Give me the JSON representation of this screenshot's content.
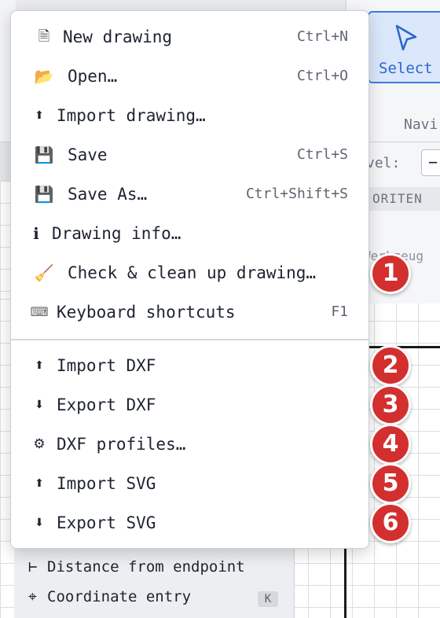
{
  "menu": {
    "items": [
      {
        "icon": "🗎",
        "icon_name": "document-icon",
        "label": "New drawing",
        "shortcut": "Ctrl+N"
      },
      {
        "icon": "📂",
        "icon_name": "folder-open-icon",
        "label": "Open…",
        "shortcut": "Ctrl+O"
      },
      {
        "icon": "⬆",
        "icon_name": "import-icon",
        "label": "Import drawing…",
        "shortcut": ""
      },
      {
        "icon": "💾",
        "icon_name": "save-icon",
        "label": "Save",
        "shortcut": "Ctrl+S"
      },
      {
        "icon": "💾",
        "icon_name": "save-as-icon",
        "label": "Save As…",
        "shortcut": "Ctrl+Shift+S"
      },
      {
        "icon": "ℹ",
        "icon_name": "info-icon",
        "label": "Drawing info…",
        "shortcut": ""
      },
      {
        "icon": "🧹",
        "icon_name": "broom-icon",
        "label": "Check & clean up drawing…",
        "shortcut": ""
      },
      {
        "icon": "⌨",
        "icon_name": "keyboard-icon",
        "label": "Keyboard shortcuts",
        "shortcut": "F1"
      }
    ],
    "dxf_items": [
      {
        "icon": "⬆",
        "icon_name": "import-icon",
        "label": "Import DXF"
      },
      {
        "icon": "⬇",
        "icon_name": "export-icon",
        "label": "Export DXF"
      },
      {
        "icon": "⚙",
        "icon_name": "gear-icon",
        "label": "DXF profiles…"
      },
      {
        "icon": "⬆",
        "icon_name": "import-icon",
        "label": "Import SVG"
      },
      {
        "icon": "⬇",
        "icon_name": "export-icon",
        "label": "Export SVG"
      }
    ]
  },
  "markers": [
    "1",
    "2",
    "3",
    "4",
    "5",
    "6"
  ],
  "toolbar": {
    "select_label": "Select",
    "nav_tab": "Navi",
    "level_label": "vel:",
    "level_button": "−",
    "section_header": "ORITEN",
    "werkzeug": "Werkzeug"
  },
  "context_panel": {
    "items": [
      {
        "icon": "⊢",
        "label": "Distance from endpoint"
      },
      {
        "icon": "⌖",
        "label": "Coordinate entry",
        "key": "K"
      }
    ]
  },
  "colors": {
    "accent": "#3f7be0",
    "marker": "#d32f2f"
  }
}
